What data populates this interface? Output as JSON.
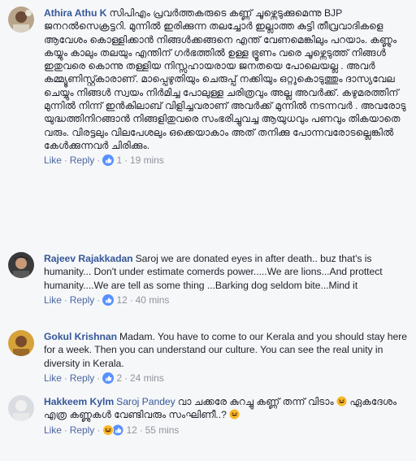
{
  "comments": [
    {
      "author": "Athira Athu K",
      "text": "സിപിഎം പ്രവർത്തകരുടെ കണ്ണ് ചൂഴ്ന്നെടുക്കുമെന്നു BJP ജനറൽസെക്രട്ടറി. മുന്നിൽ ഇരിക്കുന്ന തലച്ചോർ ഇല്ലാത്ത കുട്ടി തീവ്രവാദികളെ ആവേശം കൊള്ളിക്കാൻ നിങ്ങൾക്കങ്ങനെ എന്ത് വേണമെങ്കിലും പറയാം. കണ്ണും കയ്യും കാലും തലയും എന്തിന് ഗർഭത്തിൽ ഉള്ള ഭ്രൂണം വരെ ചൂഴ്ന്നെടുത്ത് നിങ്ങൾ ഇതുവരെ കൊന്നു തള്ളിയ നിസ്സഹായരായ ജനതയെ പോലെയല്ല . അവർ കമ്മ്യൂണിസ്റ്റ്കാരാണ്. മാപ്പെഴുതിയും ചെരുപ്പ് നക്കിയും ഒറ്റുകൊടുത്തും ദാസ്യവേല ചെയ്യും നിങ്ങൾ സ്വയം നിർമിച്ച പോലുള്ള ചരിത്രവും അല്ല അവർക്ക്. കഴുമരത്തിന് മുന്നിൽ നിന്ന് ഇൻകിലാബ് വിളിച്ചവരാണ് അവർക്ക് മുന്നിൽ നടന്നവർ . അവരോടു യുദ്ധത്തിനിറങ്ങാൻ നിങ്ങളിതുവരെ സംഭരിച്ചുവച്ച ആയുധവും പണവും തികയാതെ വരും. വിരട്ടലും വിലപേശലും ഒക്കെയാകാം അത് തനിക്കു പോന്നവരോടല്ലെങ്കിൽ കേൾക്കുന്നവർ ചിരിക്കും.",
      "like": "Like",
      "reply": "Reply",
      "reaction_count": "1",
      "time": "19 mins"
    },
    {
      "author": "Rajeev Rajakkadan",
      "text": "Saroj we are donated eyes in after death.. buz that's is humanity... Don't under estimate comerds power.....We are lions...And prottect humanity....We are tell as some thing ...Barking dog seldom bite...Mind it",
      "like": "Like",
      "reply": "Reply",
      "reaction_count": "12",
      "time": "40 mins"
    },
    {
      "author": "Gokul Krishnan",
      "text": "Madam. You have to come to our Kerala and you should stay here for a week. Then you can understand our culture. You can see the real unity in diversity in Kerala.",
      "like": "Like",
      "reply": "Reply",
      "reaction_count": "2",
      "time": "24 mins"
    },
    {
      "author": "Hakkeem Kylm",
      "tag": "Saroj Pandey",
      "text_a": "വാ ചക്കരേ കുറച്ചു കണ്ണ് തന്ന് വിടാം",
      "text_b": "ഏകദേശം എത്ര കണ്ണുകൾ വേണ്ടിവരും സംഘിണീ..?",
      "like": "Like",
      "reply": "Reply",
      "reaction_count": "12",
      "time": "55 mins"
    }
  ],
  "colors": {
    "author": "#365899",
    "meta": "#90949c",
    "like_blue": "#5890ff",
    "haha_yellow": "#f7b928"
  }
}
